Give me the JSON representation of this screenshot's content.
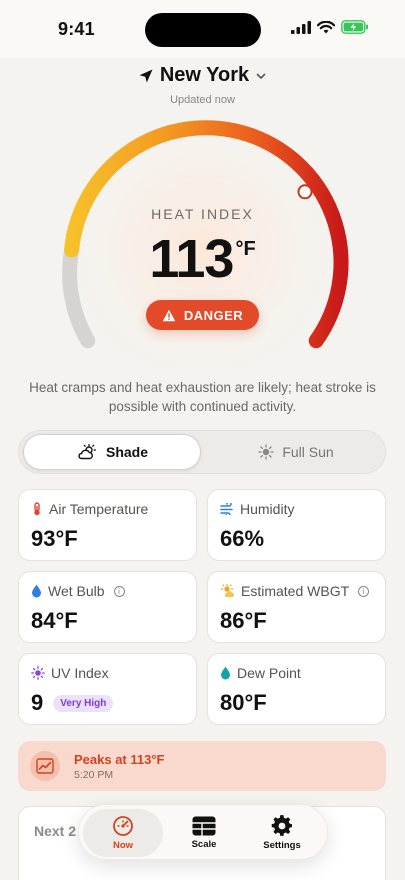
{
  "status_bar": {
    "time": "9:41"
  },
  "header": {
    "city": "New York",
    "updated": "Updated now"
  },
  "gauge": {
    "label": "HEAT INDEX",
    "value": "113",
    "unit": "°F",
    "level": 0.88,
    "status": "DANGER"
  },
  "description": "Heat cramps and heat exhaustion are likely; heat stroke is possible with continued activity.",
  "segment": {
    "shade_label": "Shade",
    "sun_label": "Full Sun",
    "selected": "Shade"
  },
  "cards": {
    "air_temp": {
      "title": "Air Temperature",
      "value": "93°F",
      "icon": "thermometer-icon"
    },
    "humidity": {
      "title": "Humidity",
      "value": "66%",
      "icon": "wind-icon"
    },
    "wet_bulb": {
      "title": "Wet Bulb",
      "value": "84°F",
      "icon": "droplet-icon"
    },
    "wbgt": {
      "title": "Estimated WBGT",
      "value": "86°F",
      "icon": "sun-cloud-icon"
    },
    "uv": {
      "title": "UV Index",
      "value": "9",
      "badge": "Very High",
      "icon": "sun-icon"
    },
    "dew_point": {
      "title": "Dew Point",
      "value": "80°F",
      "icon": "dew-drop-icon"
    }
  },
  "peak": {
    "title": "Peaks at 113°F",
    "time": "5:20 PM"
  },
  "forecast": {
    "title": "Next 2"
  },
  "tabs": {
    "now": "Now",
    "scale": "Scale",
    "settings": "Settings"
  },
  "colors": {
    "danger": "#e24a2a",
    "accent": "#d2421f",
    "background": "#f5f3ef"
  }
}
